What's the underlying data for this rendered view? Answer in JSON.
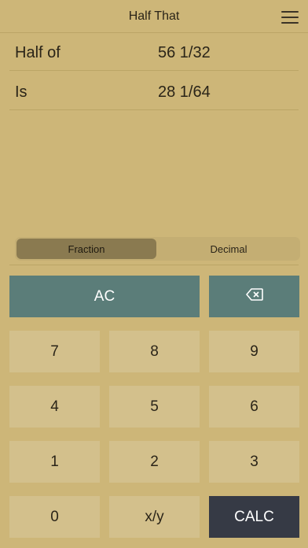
{
  "header": {
    "title": "Half That",
    "menu_icon": "hamburger-menu-icon"
  },
  "rows": [
    {
      "label": "Half of",
      "value": "56 1/32"
    },
    {
      "label": "Is",
      "value": "28 1/64"
    }
  ],
  "mode_toggle": {
    "options": [
      "Fraction",
      "Decimal"
    ],
    "selected": "Fraction"
  },
  "keypad": {
    "clear": "AC",
    "backspace_icon": "backspace-icon",
    "digits": [
      "7",
      "8",
      "9",
      "4",
      "5",
      "6",
      "1",
      "2",
      "3",
      "0"
    ],
    "fraction": "x/y",
    "calc": "CALC"
  },
  "colors": {
    "background": "#cdb678",
    "key": "#d3c08c",
    "accent_teal": "#5b7d79",
    "calc_dark": "#363a45",
    "toggle_active": "#8a7a50"
  }
}
